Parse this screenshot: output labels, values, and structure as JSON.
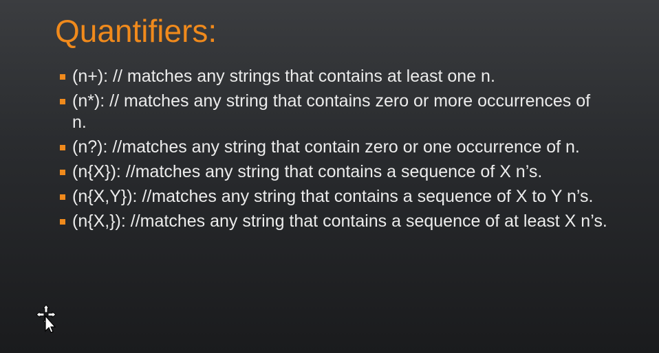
{
  "slide": {
    "title": "Quantifiers:",
    "bullets": [
      {
        "text": "(n+): // matches any strings that contains at least one n."
      },
      {
        "text": "(n*): // matches any string that contains zero or more occurrences of n."
      },
      {
        "text": "(n?): //matches any string that contain zero or one occurrence of n."
      },
      {
        "text": "(n{X}): //matches any string that contains a sequence of X n’s."
      },
      {
        "text": "(n{X,Y}): //matches any string that contains a sequence of X to Y n’s."
      },
      {
        "text": "(n{X,}): //matches any string that contains a sequence of at least X n’s."
      }
    ]
  },
  "colors": {
    "accent": "#f08a1c",
    "text": "#ececec"
  },
  "icons": {
    "cursor": "move-cursor-icon"
  }
}
